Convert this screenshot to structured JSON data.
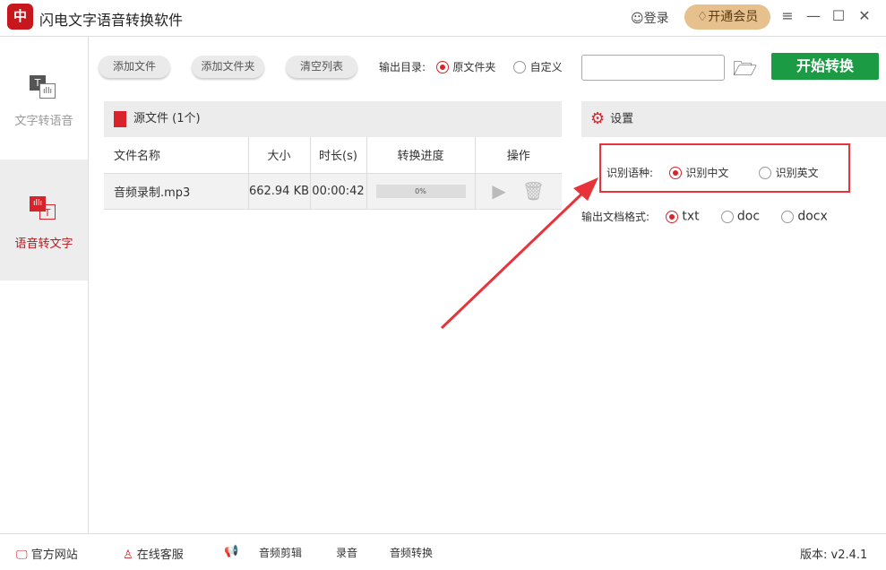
{
  "app": {
    "logo_glyph": "中",
    "title": "闪电文字语音转换软件",
    "login": "登录",
    "vip": "开通会员",
    "menu_icon": "≡",
    "minimize": "—",
    "maximize": "☐",
    "close": "✕"
  },
  "sidebar": {
    "items": [
      {
        "label": "文字转语音",
        "icon_glyph": "T"
      },
      {
        "label": "语音转文字",
        "icon_glyph": "T"
      }
    ]
  },
  "toolbar": {
    "add_file": "添加文件",
    "add_folder": "添加文件夹",
    "clear_list": "清空列表",
    "output_dir_label": "输出目录:",
    "opt_source": "原文件夹",
    "opt_custom": "自定义",
    "path_value": "",
    "start": "开始转换"
  },
  "source": {
    "title": "源文件 (1个)",
    "columns": [
      "文件名称",
      "大小",
      "时长(s)",
      "转换进度",
      "操作"
    ],
    "rows": [
      {
        "name": "音频录制.mp3",
        "size": "662.94 KB",
        "duration": "00:00:42",
        "progress_text": "0%",
        "progress": 0
      }
    ]
  },
  "settings": {
    "title": "设置",
    "lang_label": "识别语种:",
    "lang_zh": "识别中文",
    "lang_en": "识别英文",
    "format_label": "输出文档格式:",
    "formats": [
      "txt",
      "doc",
      "docx"
    ]
  },
  "footer": {
    "website": "官方网站",
    "service": "在线客服",
    "edit": "音频剪辑",
    "record": "录音",
    "convert": "音频转换",
    "version": "版本: v2.4.1"
  },
  "colors": {
    "accent": "#d9232b",
    "start": "#1a9b44",
    "vip": "#e6c08d"
  }
}
